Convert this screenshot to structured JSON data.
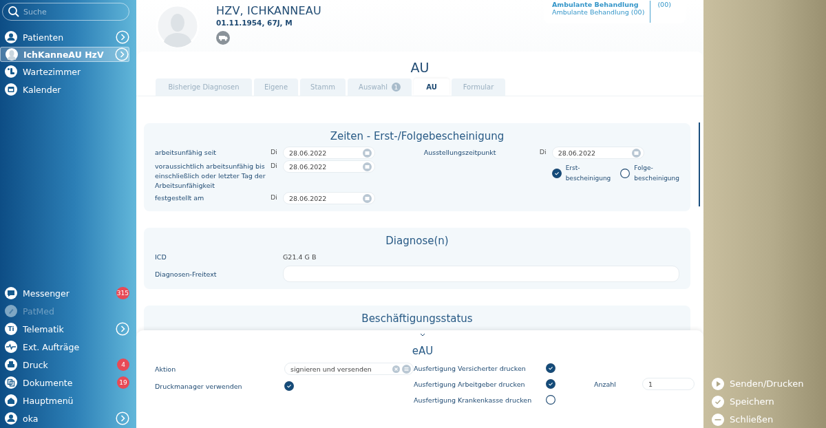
{
  "sidebar": {
    "search": {
      "placeholder": "Suche"
    },
    "top_items": [
      {
        "label": "Patienten",
        "selected": false,
        "disabled": false,
        "arrow": true
      },
      {
        "label": "IchKanneAU HzV",
        "selected": true,
        "disabled": false,
        "arrow": true
      },
      {
        "label": "Wartezimmer",
        "selected": false,
        "disabled": false,
        "arrow": false
      },
      {
        "label": "Kalender",
        "selected": false,
        "disabled": false,
        "arrow": false
      }
    ],
    "bottom_items": [
      {
        "label": "Messenger",
        "selected": false,
        "disabled": false,
        "arrow": false,
        "badge": "315"
      },
      {
        "label": "PatMed",
        "selected": false,
        "disabled": true,
        "arrow": false
      },
      {
        "label": "Telematik",
        "selected": false,
        "disabled": false,
        "arrow": true,
        "icon_text": "Ti"
      },
      {
        "label": "Ext. Aufträge",
        "selected": false,
        "disabled": false,
        "arrow": false
      },
      {
        "label": "Druck",
        "selected": false,
        "disabled": false,
        "arrow": false,
        "badge": "4"
      },
      {
        "label": "Dokumente",
        "selected": false,
        "disabled": false,
        "arrow": false,
        "badge": "19"
      },
      {
        "label": "Hauptmenü",
        "selected": false,
        "disabled": false,
        "arrow": false
      },
      {
        "label": "oka",
        "selected": false,
        "disabled": false,
        "arrow": true
      }
    ]
  },
  "patient": {
    "name": "HZV,  ICHKANNEAU",
    "info": "01.11.1954, 67J, M"
  },
  "treatment": {
    "title": "Ambulante Behandlung",
    "subtitle": "Ambulante Behandlung (00)",
    "count": "(00)"
  },
  "page_title": "AU",
  "tabs": [
    {
      "label": "Bisherige Diagnosen",
      "selected": false
    },
    {
      "label": "Eigene",
      "selected": false
    },
    {
      "label": "Stamm",
      "selected": false
    },
    {
      "label": "Auswahl",
      "selected": false,
      "badge": "1"
    },
    {
      "label": "AU",
      "selected": true
    },
    {
      "label": "Formular",
      "selected": false
    }
  ],
  "zeiten": {
    "title": "Zeiten - Erst-/Folgebescheinigung",
    "rows": [
      {
        "label": "arbeitsunfähig seit",
        "day": "Di",
        "value": "28.06.2022"
      },
      {
        "label": "voraussichtlich arbeitsunfähig bis einschließlich oder letzter Tag der Arbeitsunfähigkeit",
        "day": "Di",
        "value": "28.06.2022"
      },
      {
        "label": "festgestellt am",
        "day": "Di",
        "value": "28.06.2022"
      }
    ],
    "issue": {
      "label": "Ausstellungszeitpunkt",
      "day": "Di",
      "value": "28.06.2022"
    },
    "options": [
      {
        "label": "Erst-\nbescheinigung",
        "selected": true
      },
      {
        "label": "Folge-\nbescheinigung",
        "selected": false
      }
    ]
  },
  "diagnose": {
    "title": "Diagnose(n)",
    "icd_label": "ICD",
    "icd": "G21.4 G B",
    "freetext_label": "Diagnosen-Freitext"
  },
  "employment": {
    "title": "Beschäftigungsstatus"
  },
  "eau": {
    "title": "eAU",
    "action_label": "Aktion",
    "action": "signieren und versenden",
    "printmanager_label": "Druckmanager verwenden",
    "printmanager": true,
    "copies": [
      {
        "label": "Ausfertigung Versicherter drucken",
        "checked": true
      },
      {
        "label": "Ausfertigung Arbeitgeber drucken",
        "checked": true
      },
      {
        "label": "Ausfertigung Krankenkasse drucken",
        "checked": false
      }
    ],
    "count_label": "Anzahl",
    "count": "1"
  },
  "actions": [
    "Senden/Drucken",
    "Speichern",
    "Schließen"
  ]
}
